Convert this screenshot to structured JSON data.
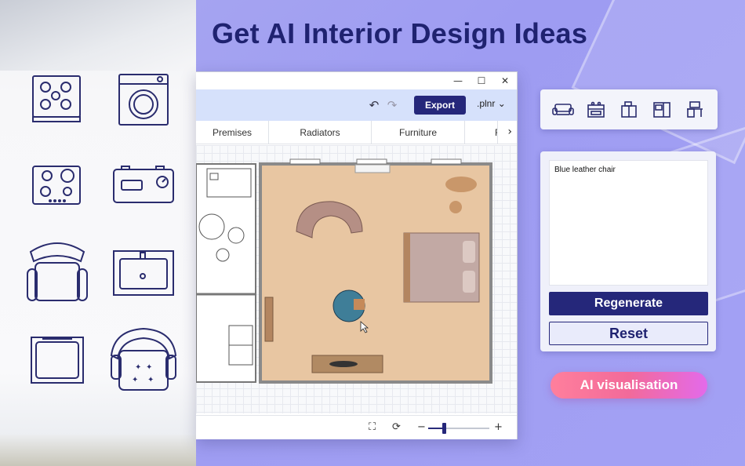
{
  "headline": "Get AI Interior Design Ideas",
  "window": {
    "controls": {
      "minimize": "—",
      "maximize": "☐",
      "close": "✕"
    },
    "toolbar": {
      "undo_icon": "undo-icon",
      "redo_icon": "redo-icon",
      "export_label": "Export",
      "format_label": ".plnr"
    },
    "tabs": [
      {
        "label": "Premises"
      },
      {
        "label": "Radiators"
      },
      {
        "label": "Furniture"
      },
      {
        "label": "F"
      }
    ],
    "statusbar": {
      "zoom_level": 0.25
    }
  },
  "left_panel_icons": [
    "gas-stove-icon",
    "washing-machine-icon",
    "cooktop-icon",
    "radio-icon",
    "armchair-icon",
    "sink-icon",
    "chair-top-icon",
    "armchair-star-icon"
  ],
  "tray_icons": [
    "sofa-icon",
    "stove-icon",
    "kitchen-cabinet-icon",
    "appliance-icon",
    "desk-icon"
  ],
  "ai_panel": {
    "prompt_text": "Blue leather chair",
    "regenerate_label": "Regenerate",
    "reset_label": "Reset"
  },
  "ai_visualisation_label": "AI visualisation",
  "colors": {
    "accent": "#25277a",
    "headline": "#1f2270",
    "toolbar": "#d6e1fb",
    "floor": "#e9c7a4"
  }
}
